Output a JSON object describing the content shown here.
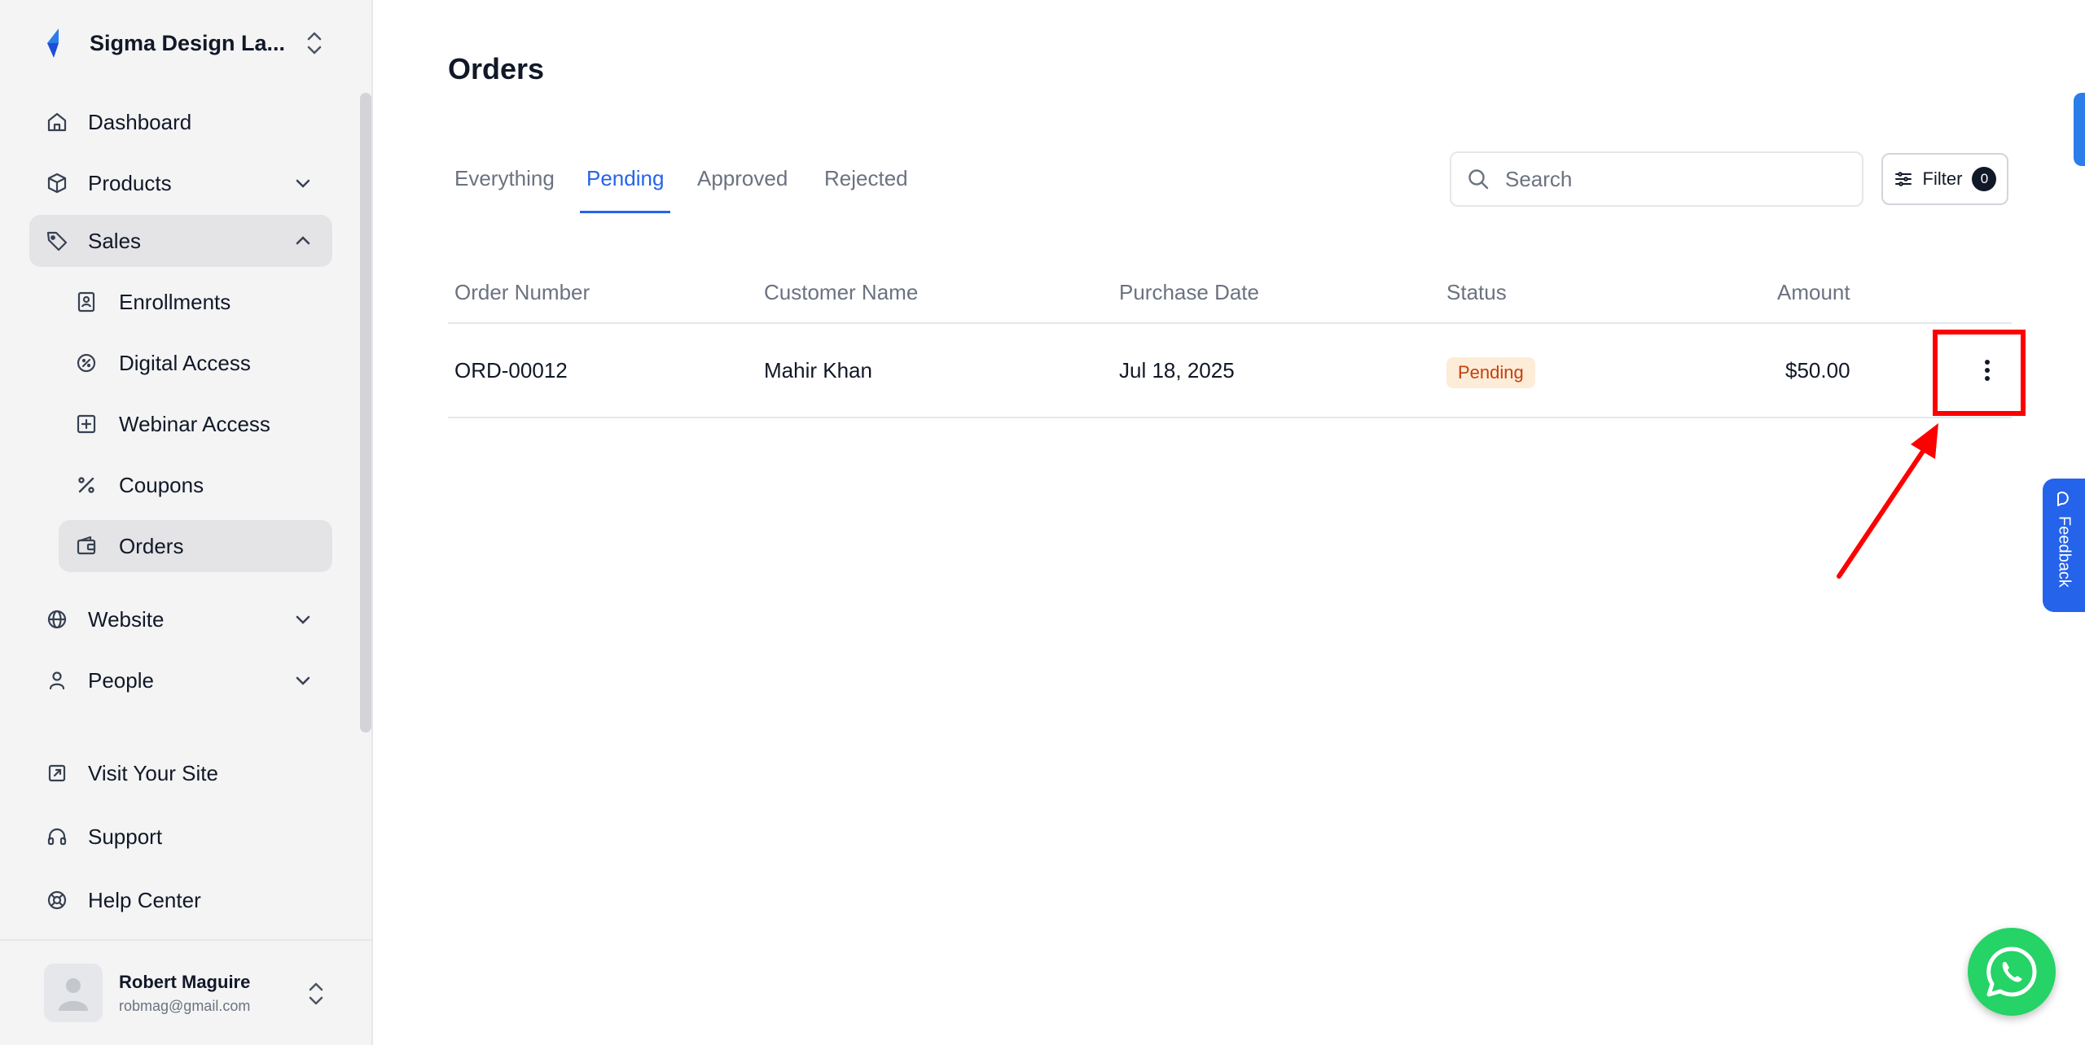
{
  "sidebar": {
    "brand_name": "Sigma Design La...",
    "items": [
      {
        "label": "Dashboard",
        "icon": "home-icon"
      },
      {
        "label": "Products",
        "icon": "box-icon"
      },
      {
        "label": "Sales",
        "icon": "tag-icon"
      },
      {
        "label": "Website",
        "icon": "globe-icon"
      },
      {
        "label": "People",
        "icon": "user-icon"
      }
    ],
    "sales_subitems": [
      {
        "label": "Enrollments",
        "icon": "contact-book-icon"
      },
      {
        "label": "Digital Access",
        "icon": "gauge-icon"
      },
      {
        "label": "Webinar Access",
        "icon": "plus-square-icon"
      },
      {
        "label": "Coupons",
        "icon": "percent-icon"
      },
      {
        "label": "Orders",
        "icon": "wallet-icon"
      }
    ],
    "bottom_links": [
      {
        "label": "Visit Your Site",
        "icon": "external-link-icon"
      },
      {
        "label": "Support",
        "icon": "headset-icon"
      },
      {
        "label": "Help Center",
        "icon": "lifebuoy-icon"
      }
    ],
    "user": {
      "name": "Robert Maguire",
      "email": "robmag@gmail.com"
    }
  },
  "main": {
    "title": "Orders",
    "tabs": [
      "Everything",
      "Pending",
      "Approved",
      "Rejected"
    ],
    "active_tab": "Pending",
    "search": {
      "placeholder": "Search",
      "value": ""
    },
    "filter": {
      "label": "Filter",
      "count": "0"
    },
    "table": {
      "columns": [
        "Order Number",
        "Customer Name",
        "Purchase Date",
        "Status",
        "Amount"
      ],
      "rows": [
        {
          "order_number": "ORD-00012",
          "customer_name": "Mahir Khan",
          "purchase_date": "Jul 18, 2025",
          "status": "Pending",
          "amount": "$50.00"
        }
      ]
    }
  },
  "widgets": {
    "feedback_label": "Feedback"
  },
  "colors": {
    "accent": "#2563eb",
    "pending_badge_bg": "#fdecd8",
    "pending_badge_text": "#c2410c",
    "annotation": "#ff0000",
    "whatsapp": "#25d366"
  }
}
